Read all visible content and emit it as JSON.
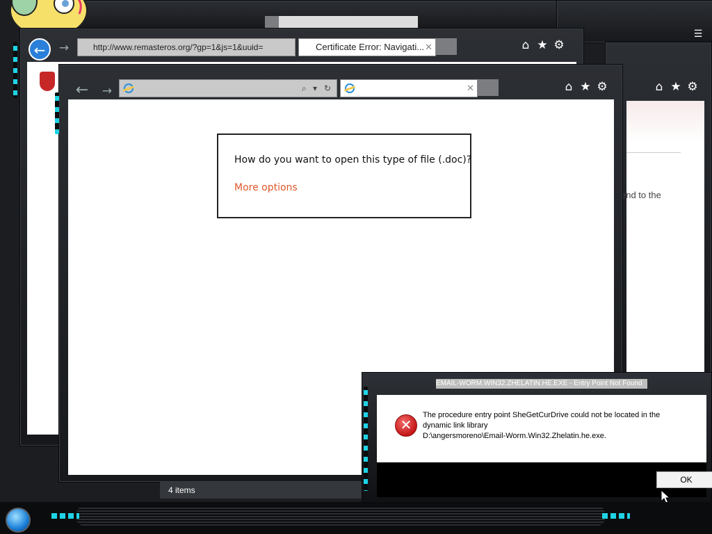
{
  "back_window": {
    "address_url": "http://www.remasteros.org/?gp=1&js=1&uuid=",
    "tab_title": "Certificate Error: Navigati..."
  },
  "right_window": {
    "partial_text": "end to the"
  },
  "front_window": {
    "address_url": "",
    "tab_title": ""
  },
  "open_with_dialog": {
    "question": "How do you want to open this type of file (.doc)?",
    "more_options": "More options"
  },
  "status_bar": {
    "items_count": "4 items"
  },
  "error_dialog": {
    "title": "EMAIL-WORM.WIN32.ZHELATIN.HE.EXE - Entry Point Not Found",
    "message_line1": "The procedure entry point SheGetCurDrive could not be located in the",
    "message_line2": "dynamic link library",
    "message_line3": "D:\\angersmoreno\\Email-Worm.Win32.Zhelatin.he.exe.",
    "ok_label": "OK"
  },
  "icons": {
    "home": "home-icon",
    "favorites": "star-icon",
    "tools": "gear-icon",
    "back": "back-arrow-icon",
    "forward": "forward-arrow-icon",
    "search": "search-icon",
    "refresh": "refresh-icon",
    "close_tab": "close-icon",
    "error": "error-icon",
    "start": "start-orb-icon"
  },
  "colors": {
    "accent_cyan": "#1fd3e6",
    "link_orange": "#e0582a",
    "error_red": "#c51616"
  }
}
